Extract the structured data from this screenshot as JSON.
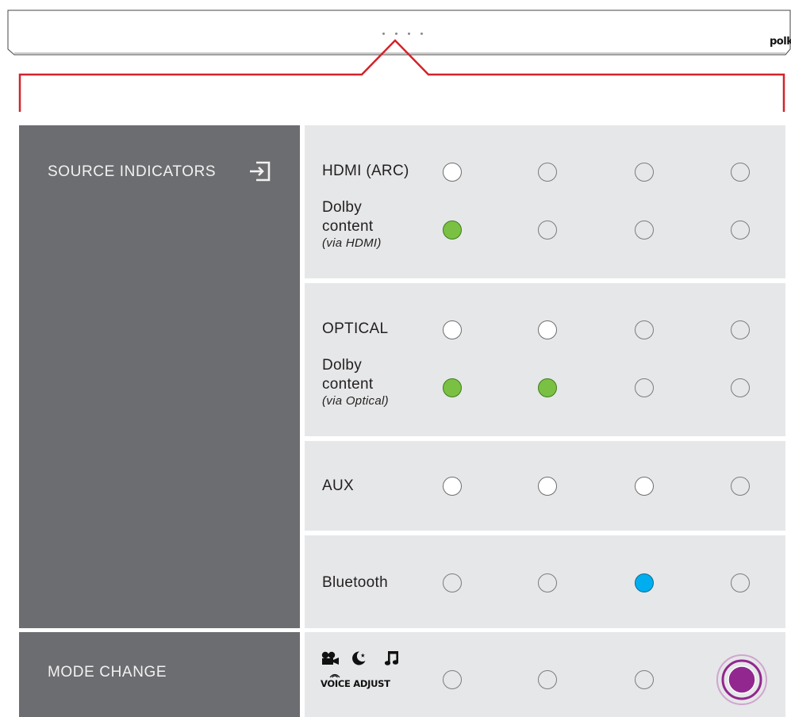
{
  "brand": "polk",
  "sections": {
    "source_title": "SOURCE INDICATORS",
    "mode_title": "MODE CHANGE"
  },
  "rows": {
    "hdmi": {
      "label": "HDMI (ARC)",
      "leds": [
        "white",
        "off",
        "off",
        "off"
      ]
    },
    "hdmi_dolby": {
      "label_line1": "Dolby",
      "label_line2": "content",
      "label_sub": "(via HDMI)",
      "leds": [
        "green",
        "off",
        "off",
        "off"
      ]
    },
    "optical": {
      "label": "OPTICAL",
      "leds": [
        "white",
        "white",
        "off",
        "off"
      ]
    },
    "optical_dolby": {
      "label_line1": "Dolby",
      "label_line2": "content",
      "label_sub": "(via Optical)",
      "leds": [
        "green",
        "green",
        "off",
        "off"
      ]
    },
    "aux": {
      "label": "AUX",
      "leds": [
        "white",
        "white",
        "white",
        "off"
      ]
    },
    "bluetooth": {
      "label": "Bluetooth",
      "leds": [
        "off",
        "off",
        "blue",
        "off"
      ]
    },
    "mode": {
      "voice_adjust_label": "VOICE ADJUST",
      "leds": [
        "off",
        "off",
        "off",
        "purple-ring"
      ]
    }
  },
  "colors": {
    "white_led": "#ffffff",
    "green_led": "#7ac143",
    "blue_led": "#00aeef",
    "purple_led": "#92278f",
    "bracket_red": "#d2232a",
    "panel_dark": "#6c6d70",
    "panel_light": "#e6e7e8"
  },
  "icons": [
    "movie-camera-icon",
    "night-moon-icon",
    "music-note-icon",
    "voice-adjust-icon",
    "source-input-icon"
  ]
}
